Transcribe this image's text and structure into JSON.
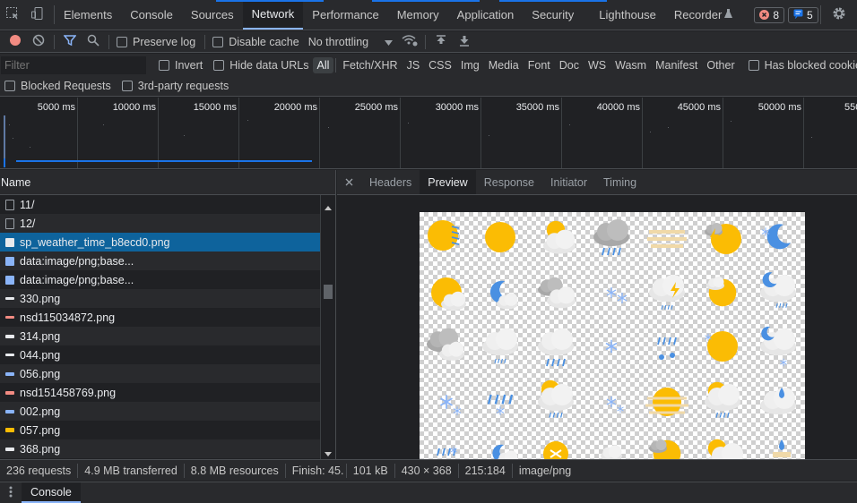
{
  "tabs": [
    {
      "label": "Elements"
    },
    {
      "label": "Console"
    },
    {
      "label": "Sources"
    },
    {
      "label": "Network",
      "active": true
    },
    {
      "label": "Performance"
    },
    {
      "label": "Memory"
    },
    {
      "label": "Application"
    },
    {
      "label": "Security"
    },
    {
      "label": "Lighthouse"
    },
    {
      "label": "Recorder"
    }
  ],
  "badges": {
    "errors": "8",
    "messages": "5"
  },
  "toolbar": {
    "preserve_log": "Preserve log",
    "disable_cache": "Disable cache",
    "throttling": "No throttling"
  },
  "filter": {
    "placeholder": "Filter",
    "invert": "Invert",
    "hide_data_urls": "Hide data URLs",
    "types": [
      "All",
      "Fetch/XHR",
      "JS",
      "CSS",
      "Img",
      "Media",
      "Font",
      "Doc",
      "WS",
      "Wasm",
      "Manifest",
      "Other"
    ],
    "active_type": "All",
    "has_blocked_cookies": "Has blocked cookies",
    "blocked_requests": "Blocked Requests",
    "third_party": "3rd-party requests"
  },
  "timeline": {
    "ticks": [
      "5000 ms",
      "10000 ms",
      "15000 ms",
      "20000 ms",
      "25000 ms",
      "30000 ms",
      "35000 ms",
      "40000 ms",
      "45000 ms",
      "50000 ms",
      "550"
    ]
  },
  "requests": {
    "header": "Name",
    "items": [
      {
        "name": "11/",
        "icon": "doc-icon"
      },
      {
        "name": "12/",
        "icon": "doc-icon"
      },
      {
        "name": "sp_weather_time_b8ecd0.png",
        "icon": "image-icon",
        "selected": true
      },
      {
        "name": "data:image/png;base...",
        "icon": "image-icon"
      },
      {
        "name": "data:image/png;base...",
        "icon": "image-icon"
      },
      {
        "name": "330.png",
        "icon": "image-icon"
      },
      {
        "name": "nsd115034872.png",
        "icon": "image-icon"
      },
      {
        "name": "314.png",
        "icon": "image-icon"
      },
      {
        "name": "044.png",
        "icon": "image-icon"
      },
      {
        "name": "056.png",
        "icon": "image-icon"
      },
      {
        "name": "nsd151458769.png",
        "icon": "image-icon"
      },
      {
        "name": "002.png",
        "icon": "image-icon"
      },
      {
        "name": "057.png",
        "icon": "image-icon"
      },
      {
        "name": "368.png",
        "icon": "image-icon"
      }
    ]
  },
  "detail": {
    "tabs": [
      "Headers",
      "Preview",
      "Response",
      "Initiator",
      "Timing"
    ],
    "active_tab": "Preview",
    "image_info": {
      "size": "101 kB",
      "dimensions": "430 × 368",
      "cursor": "215:184",
      "mime": "image/png"
    }
  },
  "status": {
    "requests": "236 requests",
    "transferred": "4.9 MB transferred",
    "resources": "8.8 MB resources",
    "finish": "Finish: 45."
  },
  "drawer": {
    "tab": "Console"
  },
  "colors": {
    "accent": "#8ab4f8",
    "selection": "#0e639c",
    "sun": "#fbbc04",
    "rain": "#4a90e2"
  }
}
